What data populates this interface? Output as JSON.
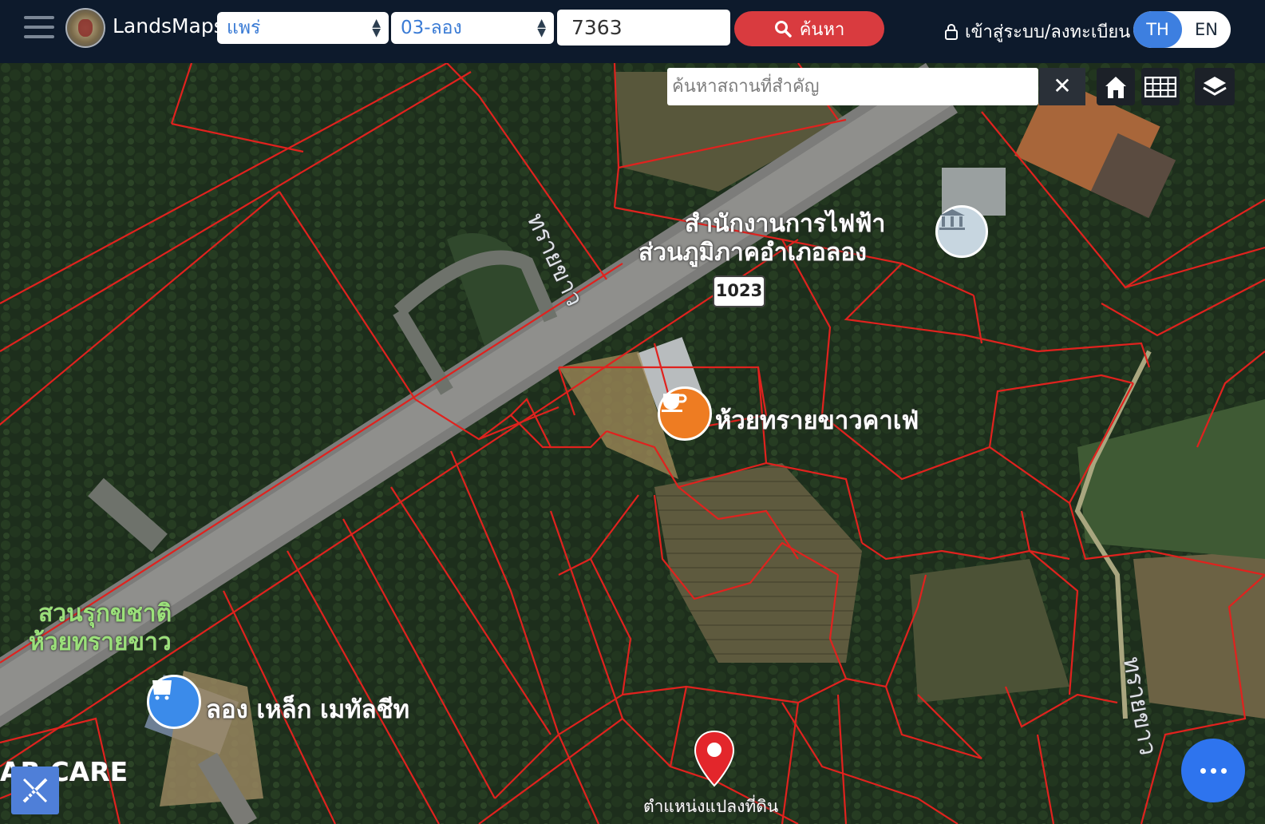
{
  "header": {
    "brand": "LandsMaps",
    "province": "แพร่",
    "district": "03-ลอง",
    "parcel_number": "7363",
    "search_label": "ค้นหา",
    "login_label": "เข้าสู่ระบบ/ลงทะเบียน",
    "lang_th": "TH",
    "lang_en": "EN",
    "active_lang": "TH"
  },
  "map_controls": {
    "place_search_placeholder": "ค้นหาสถานที่สำคัญ",
    "close_symbol": "✕",
    "tools": [
      "home-icon",
      "grid-icon",
      "layers-icon"
    ]
  },
  "map_labels": {
    "electricity_office_line1": "สำนักงานการไฟฟ้า",
    "electricity_office_line2": "ส่วนภูมิภาคอำเภอลอง",
    "route_number": "1023",
    "cafe": "ห้วยทรายขาวคาเฟ่",
    "park_line1": "สวนรุกขชาติ",
    "park_line2": "ห้วยทรายขาว",
    "shop": "ลอง เหล็ก เมทัลชีท",
    "car_care": "AR CARE",
    "road_north": "ทรายขาว",
    "road_east": "ทรายขาว",
    "marker_label": "ตำแหน่งแปลงที่ดิน"
  },
  "colors": {
    "topbar": "#0d1a2c",
    "search_button": "#d93b3f",
    "active_lang": "#3d7fe0",
    "parcel_lines": "#e0221e",
    "fab": "#2e74ee"
  }
}
